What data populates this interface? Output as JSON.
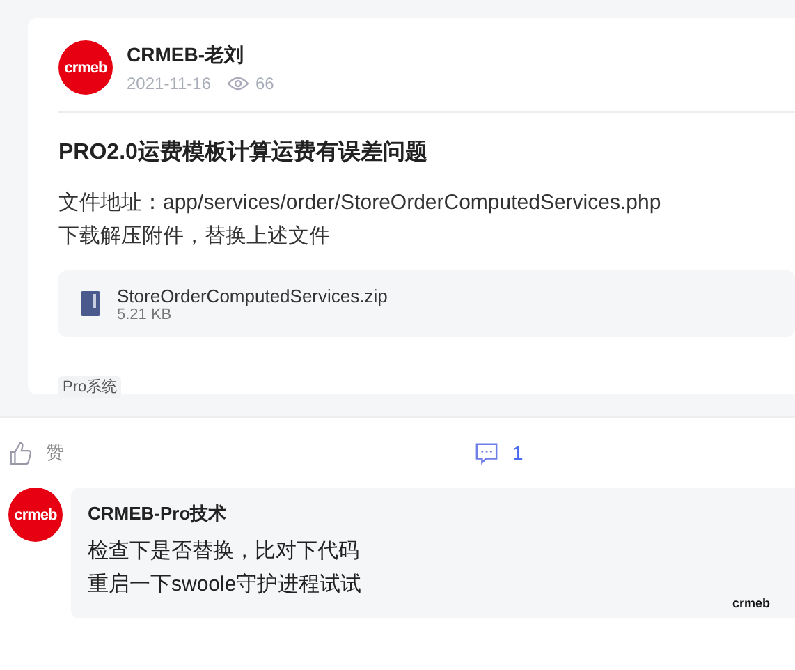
{
  "post": {
    "avatar_logo": "crmeb",
    "author": "CRMEB-老刘",
    "date": "2021-11-16",
    "views": "66",
    "title": "PRO2.0运费模板计算运费有误差问题",
    "body": [
      "文件地址：app/services/order/StoreOrderComputedServices.php",
      "下载解压附件，替换上述文件"
    ],
    "attachment": {
      "name": "StoreOrderComputedServices.zip",
      "size": "5.21 KB"
    },
    "tags": [
      "Pro系统"
    ]
  },
  "actions": {
    "like_label": "赞",
    "comment_count": "1"
  },
  "comments": [
    {
      "avatar_logo": "crmeb",
      "author": "CRMEB-Pro技术",
      "lines": [
        "检查下是否替换，比对下代码",
        "重启一下swoole守护进程试试"
      ],
      "badge_logo": "crmeb"
    }
  ]
}
